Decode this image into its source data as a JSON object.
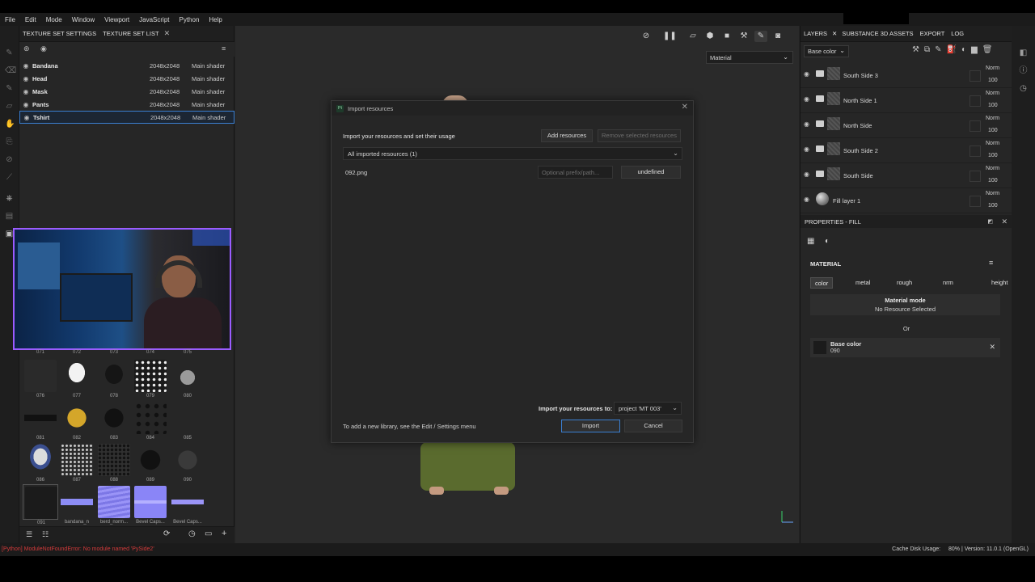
{
  "menu": [
    "File",
    "Edit",
    "Mode",
    "Window",
    "Viewport",
    "JavaScript",
    "Python",
    "Help"
  ],
  "left_panel": {
    "tabs": [
      "TEXTURE SET SETTINGS",
      "TEXTURE SET LIST"
    ],
    "texture_sets": [
      {
        "name": "Bandana",
        "resolution": "2048x2048",
        "shader": "Main shader"
      },
      {
        "name": "Head",
        "resolution": "2048x2048",
        "shader": "Main shader"
      },
      {
        "name": "Mask",
        "resolution": "2048x2048",
        "shader": "Main shader"
      },
      {
        "name": "Pants",
        "resolution": "2048x2048",
        "shader": "Main shader"
      },
      {
        "name": "Tshirt",
        "resolution": "2048x2048",
        "shader": "Main shader",
        "selected": true
      }
    ]
  },
  "shelf": {
    "top_labels": [
      "071",
      "072",
      "073",
      "074",
      "075"
    ],
    "items": [
      {
        "label": "076"
      },
      {
        "label": "077"
      },
      {
        "label": "078"
      },
      {
        "label": "079"
      },
      {
        "label": "080"
      },
      {
        "label": "081"
      },
      {
        "label": "082"
      },
      {
        "label": "083"
      },
      {
        "label": "084"
      },
      {
        "label": "085"
      },
      {
        "label": "086"
      },
      {
        "label": "087"
      },
      {
        "label": "088"
      },
      {
        "label": "089"
      },
      {
        "label": "090"
      },
      {
        "label": "091"
      },
      {
        "label": "bandana_n"
      },
      {
        "label": "berd_norm..."
      },
      {
        "label": "Bevel Caps..."
      },
      {
        "label": "Bevel Caps..."
      }
    ]
  },
  "viewport": {
    "material_select": "Material"
  },
  "dialog": {
    "app_logo": "Pt",
    "title": "Import resources",
    "heading": "Import your resources and set their usage",
    "add_resources": "Add resources",
    "remove_selected": "Remove selected resources",
    "filter": "All imported resources (1)",
    "file": {
      "name": "092.png",
      "prefix_placeholder": "Optional prefix/path...",
      "usage": "undefined"
    },
    "import_to_label": "Import your resources to:",
    "import_to_value": "project 'MT 003'",
    "footer_hint": "To add a new library, see the Edit / Settings menu",
    "import_button": "Import",
    "cancel_button": "Cancel"
  },
  "right_panel": {
    "tabs": [
      "LAYERS",
      "SUBSTANCE 3D ASSETS",
      "EXPORT",
      "LOG"
    ],
    "channel_select": "Base color",
    "layers": [
      {
        "name": "South Side 3",
        "type": "folder",
        "blend": "Norm",
        "opacity": "100"
      },
      {
        "name": "North Side 1",
        "type": "folder",
        "blend": "Norm",
        "opacity": "100"
      },
      {
        "name": "North Side",
        "type": "folder",
        "blend": "Norm",
        "opacity": "100"
      },
      {
        "name": "South Side 2",
        "type": "folder",
        "blend": "Norm",
        "opacity": "100"
      },
      {
        "name": "South Side",
        "type": "folder",
        "blend": "Norm",
        "opacity": "100"
      },
      {
        "name": "Fill layer 1",
        "type": "fill",
        "blend": "Norm",
        "opacity": "100"
      }
    ],
    "properties_title": "PROPERTIES - FILL",
    "material_section": "MATERIAL",
    "channels": [
      "color",
      "metal",
      "rough",
      "nrm",
      "height"
    ],
    "material_mode_title": "Material mode",
    "material_mode_value": "No Resource Selected",
    "or_label": "Or",
    "base_color_title": "Base color",
    "base_color_value": "090"
  },
  "status": {
    "error": "[Python] ModuleNotFoundError: No module named 'PySide2'",
    "cache_label": "Cache Disk Usage:",
    "cache_value": "80%",
    "version": "| Version: 11.0.1 (OpenGL)"
  }
}
